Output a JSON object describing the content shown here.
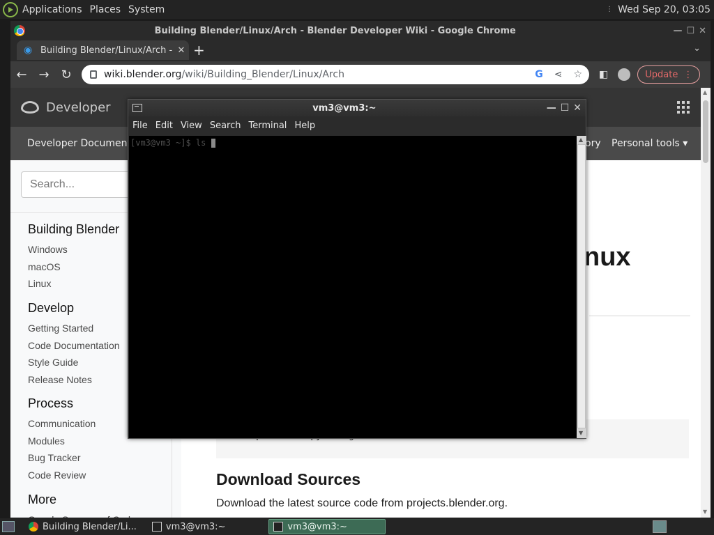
{
  "top_panel": {
    "menus": [
      "Applications",
      "Places",
      "System"
    ],
    "clock": "Wed Sep 20, 03:05"
  },
  "chrome": {
    "window_title": "Building Blender/Linux/Arch - Blender Developer Wiki - Google Chrome",
    "tab_label": "Building Blender/Linux/Arch - B",
    "url_host": "wiki.blender.org",
    "url_path": "/wiki/Building_Blender/Linux/Arch",
    "update_label": "Update"
  },
  "page": {
    "brand": "Developer",
    "nav_left": "Developer Documentation",
    "nav_history": "ory",
    "nav_tools": "Personal tools ▾",
    "search_placeholder": "Search...",
    "sidebar": [
      {
        "heading": "Building Blender",
        "links": [
          "Windows",
          "macOS",
          "Linux"
        ]
      },
      {
        "heading": "Develop",
        "links": [
          "Getting Started",
          "Code Documentation",
          "Style Guide",
          "Release Notes"
        ]
      },
      {
        "heading": "Process",
        "links": [
          "Communication",
          "Modules",
          "Bug Tracker",
          "Code Review"
        ]
      },
      {
        "heading": "More",
        "links": [
          "Google Summer of Code"
        ]
      }
    ],
    "title_fragment": "nux",
    "code": "sudo pacman -S python git",
    "download_heading": "Download Sources",
    "download_text": "Download the latest source code from projects.blender.org."
  },
  "terminal": {
    "title": "vm3@vm3:~",
    "menus": [
      "File",
      "Edit",
      "View",
      "Search",
      "Terminal",
      "Help"
    ],
    "prompt_line": "[vm3@vm3 ~]$ ls "
  },
  "taskbar": {
    "tasks": [
      "Building Blender/Li...",
      "vm3@vm3:~",
      "vm3@vm3:~"
    ]
  }
}
